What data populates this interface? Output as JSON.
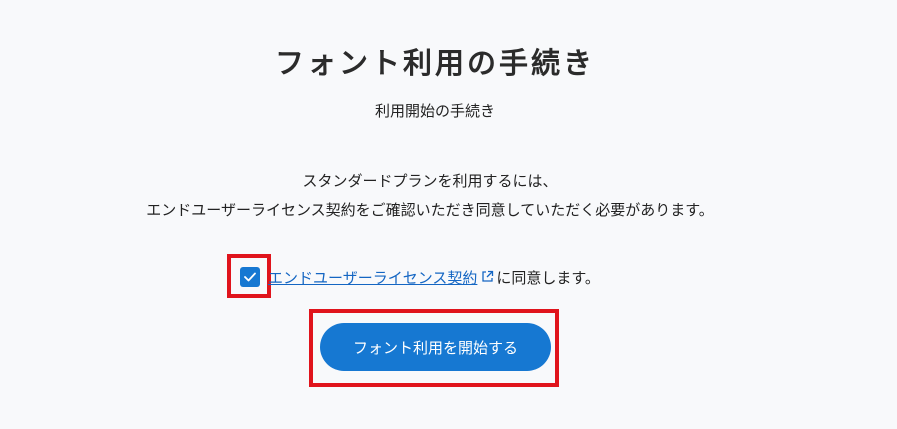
{
  "page": {
    "title": "フォント利用の手続き",
    "subtitle": "利用開始の手続き",
    "description_line1": "スタンダードプランを利用するには、",
    "description_line2": "エンドユーザーライセンス契約をご確認いただき同意していただく必要があります。"
  },
  "agreement": {
    "checked": true,
    "link_label": "エンドユーザーライセンス契約",
    "suffix_text": "に同意します。",
    "link_icon": "external-link-icon",
    "checkbox_icon": "check-icon"
  },
  "actions": {
    "start_button_label": "フォント利用を開始する"
  },
  "colors": {
    "accent": "#1678d2",
    "link": "#1466c3",
    "highlight": "#e0141c",
    "background": "#f8f9fb"
  }
}
